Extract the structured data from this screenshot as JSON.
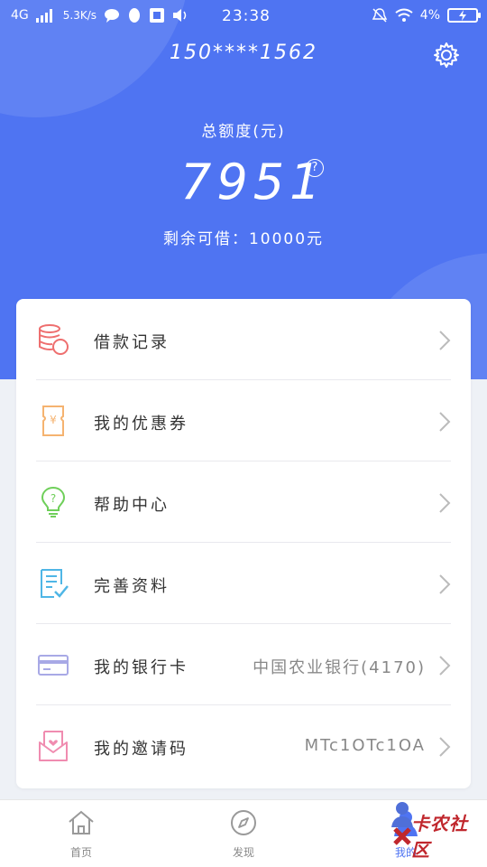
{
  "status_bar": {
    "network": "4G",
    "speed": "5.3K/s",
    "time": "23:38",
    "battery": "4%"
  },
  "header": {
    "phone": "150****1562",
    "total_label": "总额度(元)",
    "amount": "7951",
    "help_icon": "question-circle-icon",
    "remaining": "剩余可借：10000元"
  },
  "menu": [
    {
      "label": "借款记录",
      "value": "",
      "icon": "coins-icon",
      "color": "#ee6f6f"
    },
    {
      "label": "我的优惠券",
      "value": "",
      "icon": "coupon-icon",
      "color": "#f5b370"
    },
    {
      "label": "帮助中心",
      "value": "",
      "icon": "lightbulb-icon",
      "color": "#6fcf5a"
    },
    {
      "label": "完善资料",
      "value": "",
      "icon": "document-check-icon",
      "color": "#4fb6e6"
    },
    {
      "label": "我的银行卡",
      "value": "中国农业银行(4170)",
      "icon": "bank-card-icon",
      "color": "#a8a9e6"
    },
    {
      "label": "我的邀请码",
      "value": "MTc1OTc1OA",
      "icon": "invite-envelope-icon",
      "color": "#f08cb0"
    }
  ],
  "tabs": [
    {
      "label": "首页",
      "icon": "home-icon"
    },
    {
      "label": "发现",
      "icon": "compass-icon"
    },
    {
      "label": "我的",
      "icon": "user-icon"
    }
  ],
  "watermark": "卡农社区",
  "colors": {
    "primary": "#4f74f2",
    "background": "#eef1f6"
  }
}
